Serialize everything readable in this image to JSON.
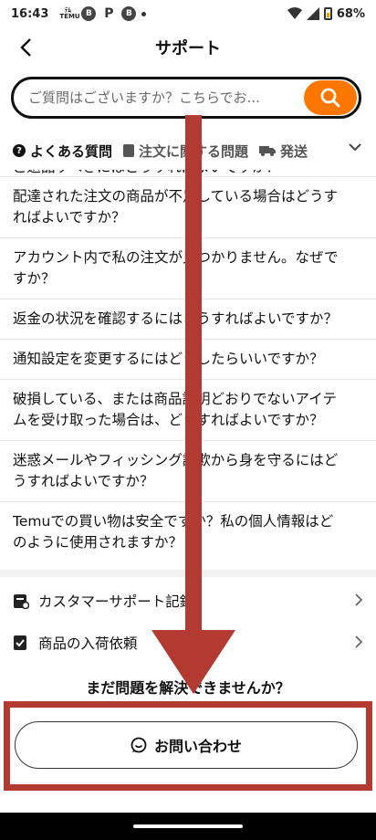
{
  "status_bar": {
    "time": "16:43",
    "app_icons": [
      "temu-icon",
      "b-icon",
      "p-icon",
      "b-icon"
    ],
    "battery": "68%"
  },
  "header": {
    "title": "サポート",
    "back_label": "<"
  },
  "search": {
    "placeholder": "ご質問はございますか？こちらでお..."
  },
  "tabs": [
    {
      "label": "よくある質問",
      "icon": "question-icon",
      "active": true
    },
    {
      "label": "注文に関する問題",
      "icon": "document-icon",
      "active": false
    },
    {
      "label": "発送",
      "icon": "truck-icon",
      "active": false
    }
  ],
  "faq": [
    "配達された注文の商品が不足している場合はどうすればよいですか？",
    "アカウント内で私の注文が見つかりません。なぜですか？",
    "返金の状況を確認するにはどうすればよいですか？",
    "通知設定を変更するにはどうしたらいいですか？",
    "破損している、または商品説明どおりでないアイテムを受け取った場合は、どうすればよいですか？",
    "迷惑メールやフィッシング詐欺から身を守るにはどうすればよいですか？",
    "Temuでの買い物は安全ですか？私の個人情報はどのように使用されますか？"
  ],
  "faq_partial": "ご返品すべきにはどうすればよいですか？",
  "menu": [
    {
      "label": "カスタマーサポート記録",
      "icon": "support-record-icon"
    },
    {
      "label": "商品の入荷依頼",
      "icon": "restock-request-icon"
    }
  ],
  "help_text": "まだ問題を解決できませんか？",
  "contact_button": "お問い合わせ",
  "colors": {
    "accent": "#fb7701",
    "annotation": "#b33a30"
  }
}
